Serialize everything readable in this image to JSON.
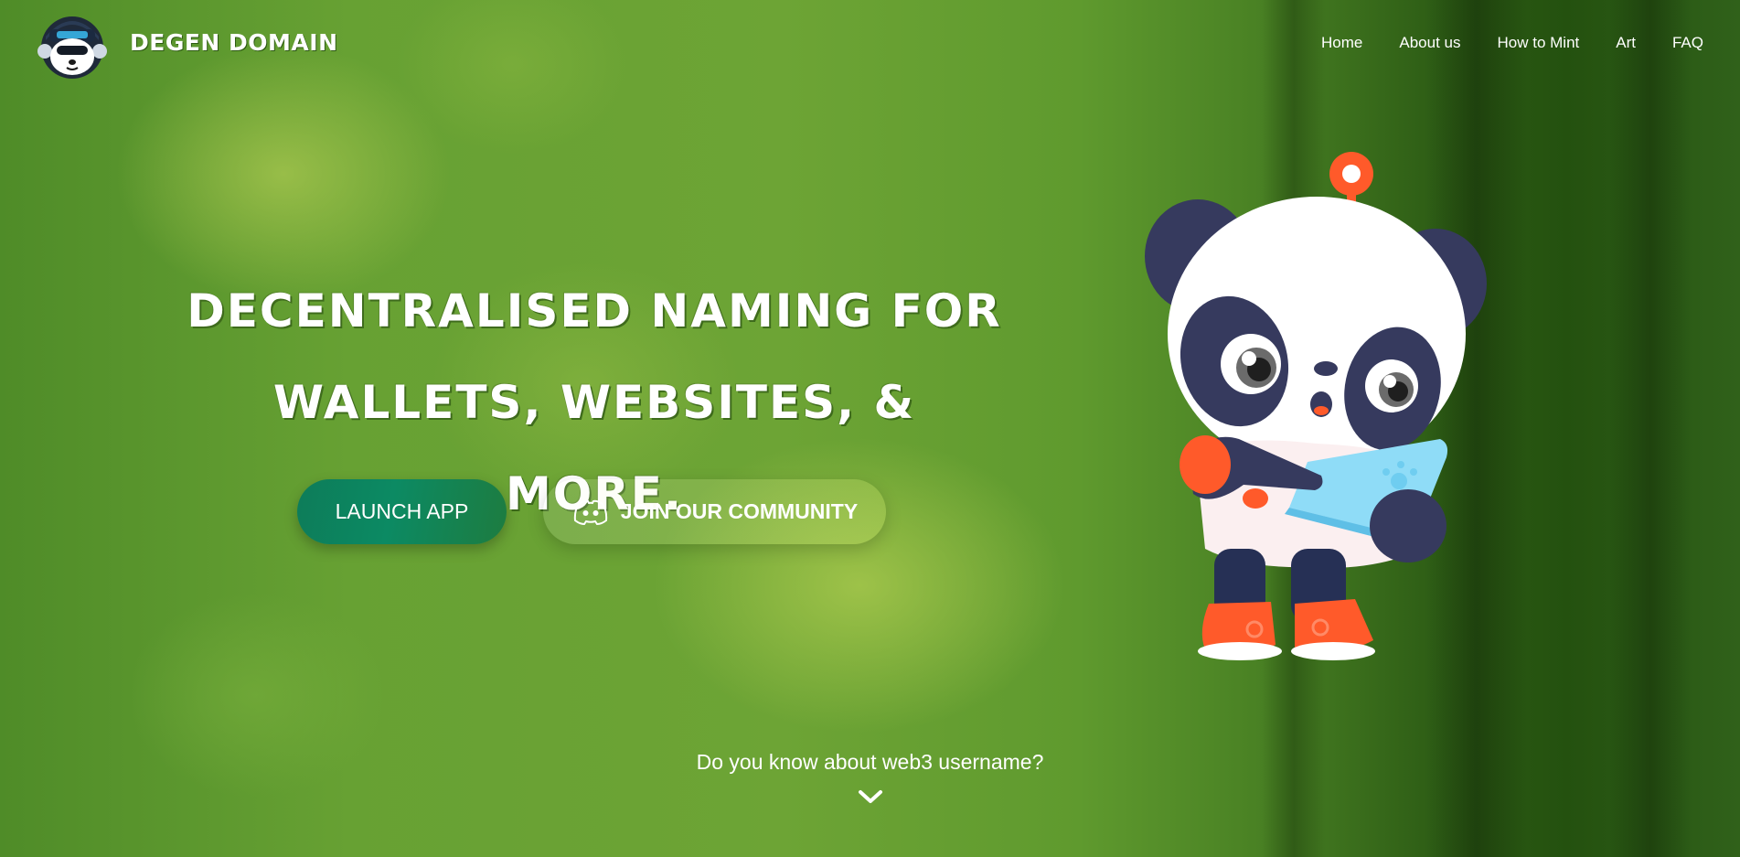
{
  "brand": {
    "name": "DEGEN DOMAIN",
    "logo_icon": "panda-mascot-logo-icon"
  },
  "nav": {
    "items": [
      "Home",
      "About us",
      "How to Mint",
      "Art",
      "FAQ"
    ]
  },
  "hero": {
    "title_line1": "DECENTRALISED NAMING FOR",
    "title_line2": "WALLETS, WEBSITES, & MORE.",
    "launch_button": "LAUNCH APP",
    "community_button": "JOIN OUR COMMUNITY",
    "community_icon": "discord-icon",
    "mascot": "panda-with-laptop-illustration"
  },
  "footer_prompt": {
    "text": "Do you know about web3 username?",
    "icon": "chevron-down-icon"
  },
  "colors": {
    "launch_button": "#0c8a63",
    "mascot_accent": "#ff5a2a",
    "mascot_dark": "#363a5e",
    "laptop": "#8fdcf7"
  }
}
